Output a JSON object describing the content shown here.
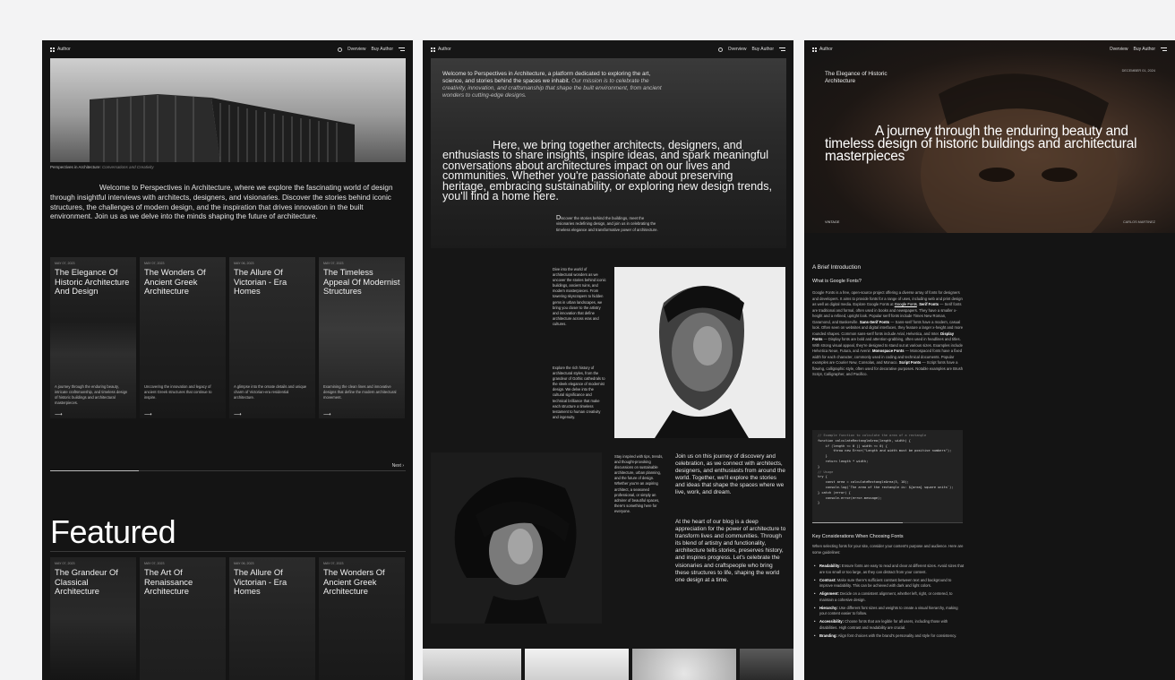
{
  "nav": {
    "logo": "Author",
    "overview": "Overview",
    "buy": "Buy Author"
  },
  "home": {
    "caption_prefix": "Perspectives in Architecture:",
    "caption_suffix": "Conversations and Creativity",
    "intro": "Welcome to Perspectives in Architecture, where we explore the fascinating world of design through insightful interviews with architects, designers, and visionaries. Discover the stories behind iconic structures, the challenges of modern design, and the inspiration that drives innovation in the built environment. Join us as we delve into the minds shaping the future of architecture.",
    "cards": [
      {
        "date": "MAY 07, 2023",
        "title": "The Elegance Of Historic Architecture And Design",
        "excerpt": "A journey through the enduring beauty, intricate craftsmanship, and timeless design of historic buildings and architectural masterpieces."
      },
      {
        "date": "MAY 07, 2023",
        "title": "The Wonders Of Ancient Greek Architecture",
        "excerpt": "Uncovering the innovation and legacy of ancient Greek structures that continue to inspire."
      },
      {
        "date": "MAY 06, 2023",
        "title": "The Allure Of Victorian - Era Homes",
        "excerpt": "A glimpse into the ornate details and unique charm of Victorian-era residential architecture."
      },
      {
        "date": "MAY 07, 2023",
        "title": "The Timeless Appeal Of Modernist Structures",
        "excerpt": "Examining the clean lines and innovative designs that define the modern architectural movement."
      }
    ],
    "next": "Next",
    "featured_heading": "Featured",
    "featured": [
      {
        "date": "MAY 07, 2023",
        "title": "The Grandeur Of Classical Architecture"
      },
      {
        "date": "MAY 07, 2023",
        "title": "The Art Of Renaissance Architecture"
      },
      {
        "date": "MAY 06, 2023",
        "title": "The Allure Of Victorian - Era Homes"
      },
      {
        "date": "MAY 07, 2023",
        "title": "The Wonders Of Ancient Greek Architecture"
      }
    ]
  },
  "about": {
    "welcome_plain": "Welcome to Perspectives in Architecture, a platform dedicated to exploring the art, science, and stories behind the spaces we inhabit.",
    "welcome_em": "Our mission is to celebrate the creativity, innovation, and craftsmanship that shape the built environment, from ancient wonders to cutting-edge designs.",
    "big": "Here, we bring together architects, designers, and enthusiasts to share insights, inspire ideas, and spark meaningful conversations about architectures impact on our lives and communities. Whether you're passionate about preserving heritage, embracing sustainability, or exploring new design trends, you'll find a home here.",
    "discover_first": "D",
    "discover_rest": "iscover the stories behind the buildings, meet the visionaries redefining design, and join us in celebrating the timeless elegance and transformative power of architecture.",
    "col1": "Dive into the world of architectural wonders as we uncover the stories behind iconic buildings, ancient ruins, and modern masterpieces. From towering skyscrapers to hidden gems in urban landscapes, we bring you closer to the artistry and innovation that define architecture across eras and cultures.",
    "col2": "Explore the rich history of architectural styles, from the grandeur of Gothic cathedrals to the sleek elegance of modernist design. We delve into the cultural significance and technical brilliance that make each structure a timeless testament to human creativity and ingenuity.",
    "small": "Stay inspired with tips, trends, and thought-provoking discussions on sustainable architecture, urban planning, and the future of design. Whether you're an aspiring architect, a seasoned professional, or simply an admirer of beautiful spaces, there's something here for everyone.",
    "join": "Join us on this journey of discovery and celebration, as we connect with architects, designers, and enthusiasts from around the world. Together, we'll explore the stories and ideas that shape the spaces where we live, work, and dream.",
    "heart": "At the heart of our blog is a deep appreciation for the power of architecture to transform lives and communities. Through its blend of artistry and functionality, architecture tells stories, preserves history, and inspires progress. Let's celebrate the visionaries and craftspeople who bring these structures to life, shaping the world one design at a time."
  },
  "post": {
    "title": "The Elegance of Historic Architecture",
    "date": "DECEMBER 01, 2024",
    "big": "A journey through the enduring beauty and timeless design of historic buildings and architectural masterpieces",
    "category": "VINTAGE",
    "author": "CARLOS MARTINEZ",
    "h_intro": "A Brief Introduction",
    "h_what": "What is Google Fonts?",
    "p_a": "Google Fonts is a free, open-source project offering a diverse array of fonts for designers and developers. It aims to provide fonts for a range of uses, including web and print design as well as digital media. Explore Google Fonts at",
    "p_link": "Google Fonts",
    "p_serif_label": "Serif Fonts",
    "p_serif": "— Serif fonts are traditional and formal, often used in books and newspapers. They have a smaller x-height and a refined, upright look. Popular serif fonts include Times New Roman, Garamond, and Baskerville.",
    "p_sans_label": "Sans-Serif Fonts",
    "p_sans": "— Sans-serif fonts have a modern, casual look. Often seen on websites and digital interfaces, they feature a larger x-height and more rounded shapes. Common sans-serif fonts include Arial, Helvetica, and Inter.",
    "p_display_label": "Display Fonts",
    "p_display": "— Display fonts are bold and attention-grabbing, often used in headlines and titles. With strong visual appeal, they're designed to stand out at various sizes. Examples include Helvetica Neue, Futura, and Avenir.",
    "p_mono_label": "Monospace Fonts",
    "p_mono": "— Monospaced fonts have a fixed width for each character, commonly used in coding and technical documents. Popular examples are Courier New, Consolas, and Monaco.",
    "p_script_label": "Script Fonts",
    "p_script": "— Script fonts have a flowing, calligraphic style, often used for decorative purposes. Notable examples are Brush Script, Calligrapher, and Pacifico.",
    "code": [
      "// Example function to calculate the area of a rectangle",
      "function calculateRectangleArea(length, width) {",
      "    if (length <= 0 || width <= 0) {",
      "        throw new Error(\"Length and width must be positive numbers\");",
      "    }",
      "    return length * width;",
      "}",
      "// Usage",
      "try {",
      "    const area = calculateRectangleArea(5, 10);",
      "    console.log(`The area of the rectangle is: ${area} square units`);",
      "} catch (error) {",
      "    console.error(error.message);",
      "}"
    ],
    "h_key": "Key Considerations When Choosing Fonts",
    "p_key": "When selecting fonts for your site, consider your content's purpose and audience. Here are some guidelines:",
    "list": [
      {
        "label": "Readability:",
        "text": "Ensure fonts are easy to read and clear at different sizes. Avoid sizes that are too small or too large, as they can distract from your content."
      },
      {
        "label": "Contrast:",
        "text": "Make sure there's sufficient contrast between text and background to improve readability. This can be achieved with dark and light colors."
      },
      {
        "label": "Alignment:",
        "text": "Decide on a consistent alignment, whether left, right, or centered, to maintain a cohesive design."
      },
      {
        "label": "Hierarchy:",
        "text": "Use different font sizes and weights to create a visual hierarchy, making your content easier to follow."
      },
      {
        "label": "Accessibility:",
        "text": "Choose fonts that are legible for all users, including those with disabilities. High contrast and readability are crucial."
      },
      {
        "label": "Branding:",
        "text": "Align font choices with the brand's personality and style for consistency."
      }
    ]
  }
}
